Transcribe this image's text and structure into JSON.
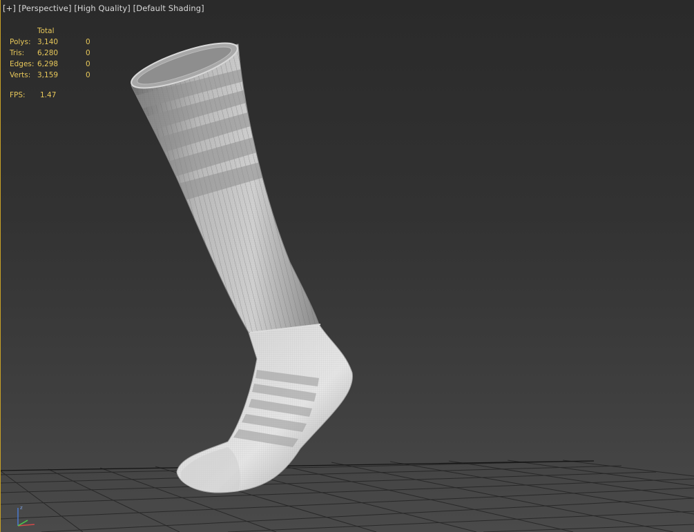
{
  "viewport": {
    "label_parts": [
      "[+]",
      "[Perspective]",
      "[High Quality]",
      "[Default Shading]"
    ]
  },
  "stats": {
    "header_total": "Total",
    "rows": [
      {
        "name": "Polys:",
        "total": "3,140",
        "selected": "0"
      },
      {
        "name": "Tris:",
        "total": "6,280",
        "selected": "0"
      },
      {
        "name": "Edges:",
        "total": "6,298",
        "selected": "0"
      },
      {
        "name": "Verts:",
        "total": "3,159",
        "selected": "0"
      }
    ],
    "fps_label": "FPS:",
    "fps_value": "1.47"
  },
  "scene": {
    "object": "sock-mesh",
    "grid": true,
    "gizmo_axes": [
      "z",
      "x",
      "y"
    ]
  },
  "colors": {
    "background_top": "#2a2a2a",
    "background_bottom": "#4a4a4a",
    "stats_text": "#e8c85a",
    "label_text": "#d9d9d9",
    "active_border": "#c9a227",
    "axis_z": "#4a7bd1",
    "axis_x": "#d14a4a",
    "axis_y": "#4ad14a"
  }
}
